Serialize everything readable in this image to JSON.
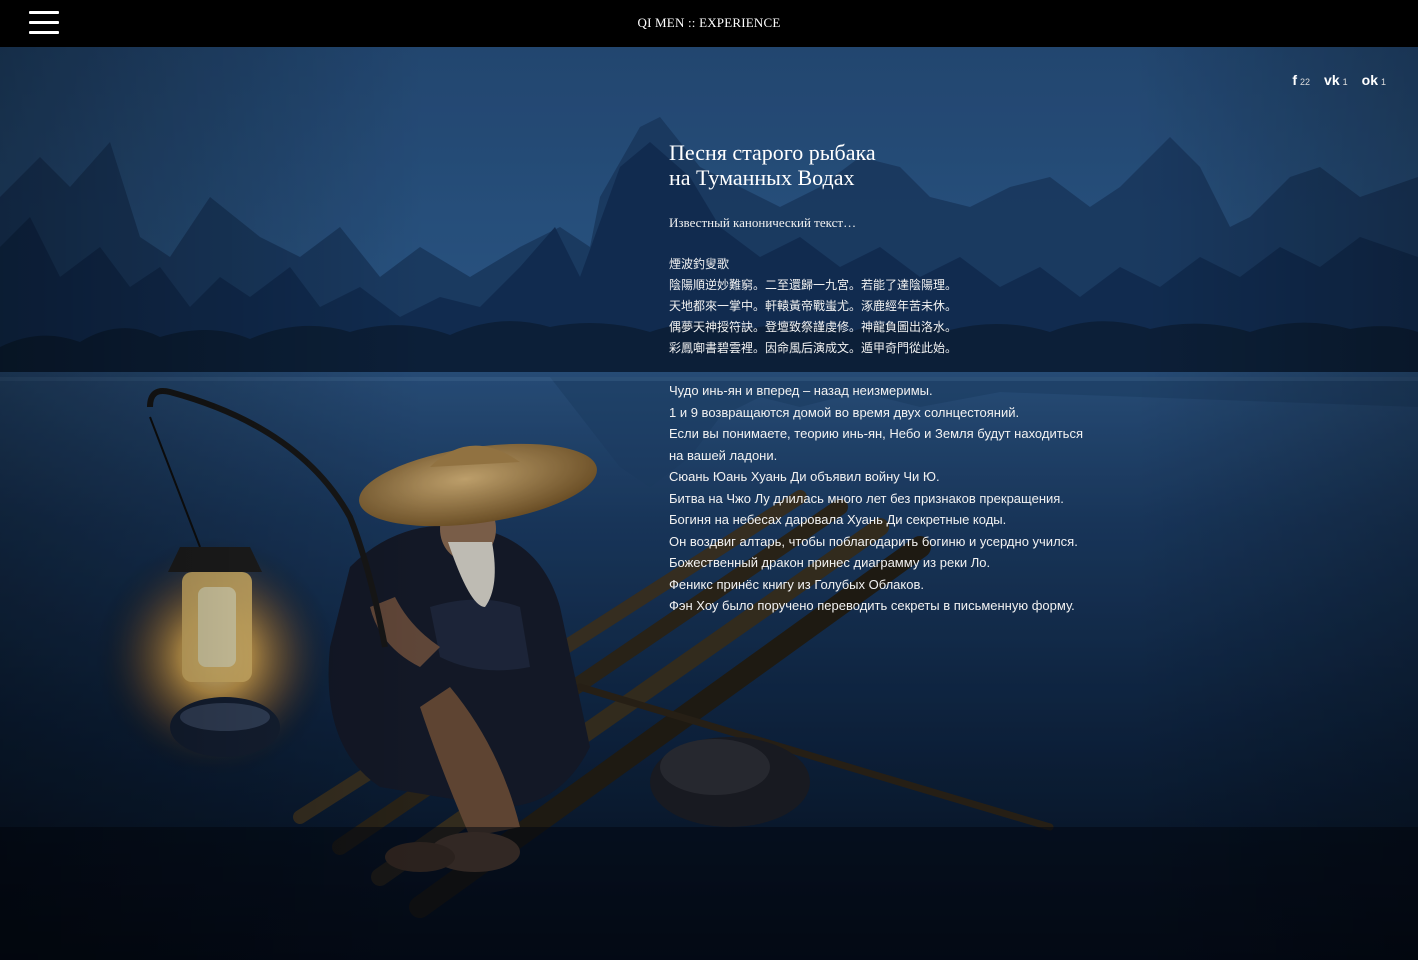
{
  "header": {
    "site_title": "QI MEN :: EXPERIENCE",
    "menu_icon": "hamburger-menu-icon"
  },
  "share": [
    {
      "icon": "facebook-icon",
      "glyph": "f",
      "count": "22"
    },
    {
      "icon": "vk-icon",
      "glyph": "vk",
      "count": "1"
    },
    {
      "icon": "odnoklassniki-icon",
      "glyph": "ok",
      "count": "1"
    }
  ],
  "article": {
    "title_line1": "Песня старого рыбака",
    "title_line2": "на Туманных Водах",
    "intro": "Известный канонический текст…",
    "chinese_lines": [
      "煙波釣叟歌",
      "陰陽順逆妙難窮。二至還歸一九宮。若能了達陰陽理。",
      "天地都來一掌中。軒轅黃帝戰蚩尤。涿鹿經年苦未休。",
      "偶夢天神授符訣。登壇致祭謹虔修。神龍負圖出洛水。",
      "彩鳳啣書碧雲裡。因命風后演成文。遁甲奇門從此始。"
    ],
    "russian_lines": [
      "Чудо инь-ян и вперед – назад неизмеримы.",
      "1 и 9 возвращаются домой во время двух солнцестояний.",
      "Если вы понимаете, теорию инь-ян, Небо и Земля будут находиться",
      "на вашей ладони.",
      "Сюань Юань Хуань Ди объявил войну Чи Ю.",
      "Битва на Чжо Лу длилась много лет без признаков прекращения.",
      "Богиня на небесах даровала Хуань Ди секретные коды.",
      "Он воздвиг алтарь, чтобы поблагодарить богиню и усердно учился.",
      "Божественный дракон принес диаграмму из реки Ло.",
      "Феникс принёс книгу из Голубых Облаков.",
      "Фэн Хоу было поручено переводить секреты в письменную форму."
    ]
  },
  "colors": {
    "topbar": "#000000",
    "sky_top": "#274e7f",
    "water": "#0d2643",
    "lantern_glow": "#ffd27a",
    "hat": "#b08a4e"
  }
}
